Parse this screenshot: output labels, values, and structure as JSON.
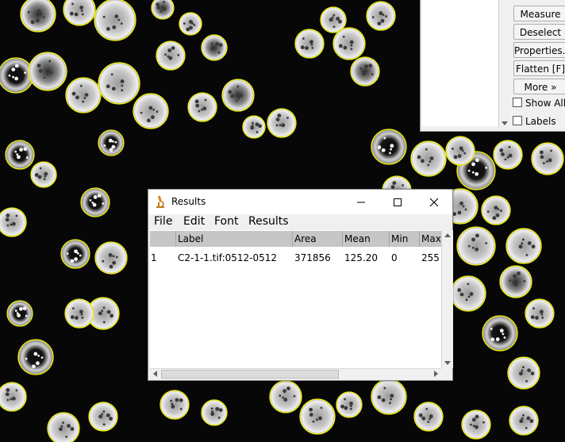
{
  "roi_manager": {
    "buttons": [
      "Measure",
      "Deselect",
      "Properties...",
      "Flatten [F]",
      "More »"
    ],
    "show_all_label": "Show All",
    "labels_label": "Labels"
  },
  "results_window": {
    "title": "Results",
    "menu": [
      "File",
      "Edit",
      "Font",
      "Results"
    ],
    "columns": [
      "",
      "Label",
      "Area",
      "Mean",
      "Min",
      "Max"
    ],
    "rows": [
      [
        "1",
        "C2-1-1.tif:0512-0512",
        "371856",
        "125.20",
        "0",
        "255"
      ]
    ]
  },
  "colors": {
    "roi_outline": "#f2f200",
    "background": "#070707",
    "header": "#c6c6c6"
  },
  "icons": [
    "microscope-icon",
    "minimize-icon",
    "maximize-icon",
    "close-icon"
  ]
}
